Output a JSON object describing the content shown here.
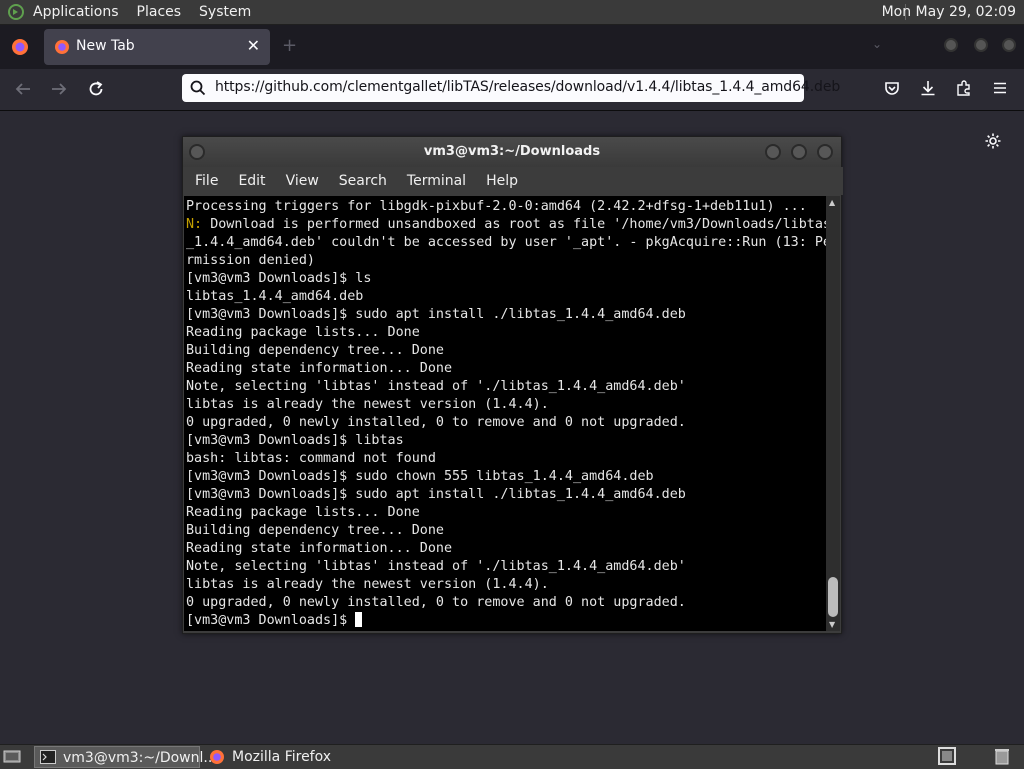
{
  "top_panel": {
    "menus": [
      "Applications",
      "Places",
      "System"
    ],
    "clock": "Mon May 29, 02:09"
  },
  "firefox": {
    "tab_title": "New Tab",
    "tab_close": "✕",
    "new_tab": "+",
    "list_tabs": "⌄",
    "url": "https://github.com/clementgallet/libTAS/releases/download/v1.4.4/libtas_1.4.4_amd64.deb",
    "icons": [
      "back-arrow-icon",
      "forward-arrow-icon",
      "reload-icon",
      "search-icon",
      "pocket-icon",
      "downloads-icon",
      "extensions-icon",
      "hamburger-menu-icon",
      "gear-icon"
    ]
  },
  "terminal": {
    "title": "vm3@vm3:~/Downloads",
    "menu": [
      "File",
      "Edit",
      "View",
      "Search",
      "Terminal",
      "Help"
    ],
    "lines": [
      {
        "prefix": "",
        "text": "Processing triggers for libgdk-pixbuf-2.0-0:amd64 (2.42.2+dfsg-1+deb11u1) ..."
      },
      {
        "prefix": "N: ",
        "text": "Download is performed unsandboxed as root as file '/home/vm3/Downloads/libtas"
      },
      {
        "prefix": "",
        "text": "_1.4.4_amd64.deb' couldn't be accessed by user '_apt'. - pkgAcquire::Run (13: Pe"
      },
      {
        "prefix": "",
        "text": "rmission denied)"
      },
      {
        "prefix": "",
        "text": "[vm3@vm3 Downloads]$ ls"
      },
      {
        "prefix": "",
        "text": "libtas_1.4.4_amd64.deb"
      },
      {
        "prefix": "",
        "text": "[vm3@vm3 Downloads]$ sudo apt install ./libtas_1.4.4_amd64.deb"
      },
      {
        "prefix": "",
        "text": "Reading package lists... Done"
      },
      {
        "prefix": "",
        "text": "Building dependency tree... Done"
      },
      {
        "prefix": "",
        "text": "Reading state information... Done"
      },
      {
        "prefix": "",
        "text": "Note, selecting 'libtas' instead of './libtas_1.4.4_amd64.deb'"
      },
      {
        "prefix": "",
        "text": "libtas is already the newest version (1.4.4)."
      },
      {
        "prefix": "",
        "text": "0 upgraded, 0 newly installed, 0 to remove and 0 not upgraded."
      },
      {
        "prefix": "",
        "text": "[vm3@vm3 Downloads]$ libtas"
      },
      {
        "prefix": "",
        "text": "bash: libtas: command not found"
      },
      {
        "prefix": "",
        "text": "[vm3@vm3 Downloads]$ sudo chown 555 libtas_1.4.4_amd64.deb"
      },
      {
        "prefix": "",
        "text": "[vm3@vm3 Downloads]$ sudo apt install ./libtas_1.4.4_amd64.deb"
      },
      {
        "prefix": "",
        "text": "Reading package lists... Done"
      },
      {
        "prefix": "",
        "text": "Building dependency tree... Done"
      },
      {
        "prefix": "",
        "text": "Reading state information... Done"
      },
      {
        "prefix": "",
        "text": "Note, selecting 'libtas' instead of './libtas_1.4.4_amd64.deb'"
      },
      {
        "prefix": "",
        "text": "libtas is already the newest version (1.4.4)."
      },
      {
        "prefix": "",
        "text": "0 upgraded, 0 newly installed, 0 to remove and 0 not upgraded."
      }
    ],
    "prompt": "[vm3@vm3 Downloads]$ "
  },
  "taskbar": {
    "terminal_task": "vm3@vm3:~/Downl...",
    "firefox_task": "Mozilla Firefox"
  },
  "colors": {
    "panel": "#3a3a3a",
    "firefox_bg": "#2b2a33",
    "terminal_bg": "#000000",
    "notice_prefix": "#c4a000"
  }
}
